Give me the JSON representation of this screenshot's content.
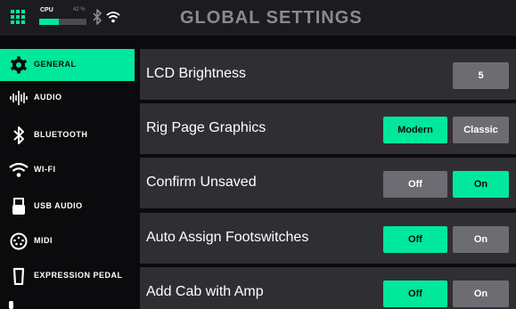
{
  "header": {
    "title": "GLOBAL SETTINGS",
    "cpu_label": "CPU",
    "cpu_percent_text": "42 %",
    "cpu_level": 0.42,
    "accent_color": "#00e89c"
  },
  "sidebar": {
    "items": [
      {
        "label": "GENERAL",
        "icon": "gear-icon",
        "active": true
      },
      {
        "label": "AUDIO",
        "icon": "waveform-icon",
        "active": false
      },
      {
        "label": "BLUETOOTH",
        "icon": "bluetooth-icon",
        "active": false
      },
      {
        "label": "WI-FI",
        "icon": "wifi-icon",
        "active": false
      },
      {
        "label": "USB AUDIO",
        "icon": "usb-icon",
        "active": false
      },
      {
        "label": "MIDI",
        "icon": "midi-icon",
        "active": false
      },
      {
        "label": "EXPRESSION PEDAL",
        "icon": "expression-pedal-icon",
        "active": false
      }
    ]
  },
  "settings": {
    "lcd_brightness": {
      "label": "LCD Brightness",
      "value": "5"
    },
    "rig_page_graphics": {
      "label": "Rig Page Graphics",
      "option_a": "Modern",
      "option_b": "Classic",
      "selected": "Modern"
    },
    "confirm_unsaved": {
      "label": "Confirm Unsaved",
      "option_a": "Off",
      "option_b": "On",
      "selected": "On"
    },
    "auto_assign_footswitches": {
      "label": "Auto Assign Footswitches",
      "option_a": "Off",
      "option_b": "On",
      "selected": "Off"
    },
    "add_cab_with_amp": {
      "label": "Add Cab with Amp",
      "option_a": "Off",
      "option_b": "On",
      "selected": "Off"
    }
  }
}
